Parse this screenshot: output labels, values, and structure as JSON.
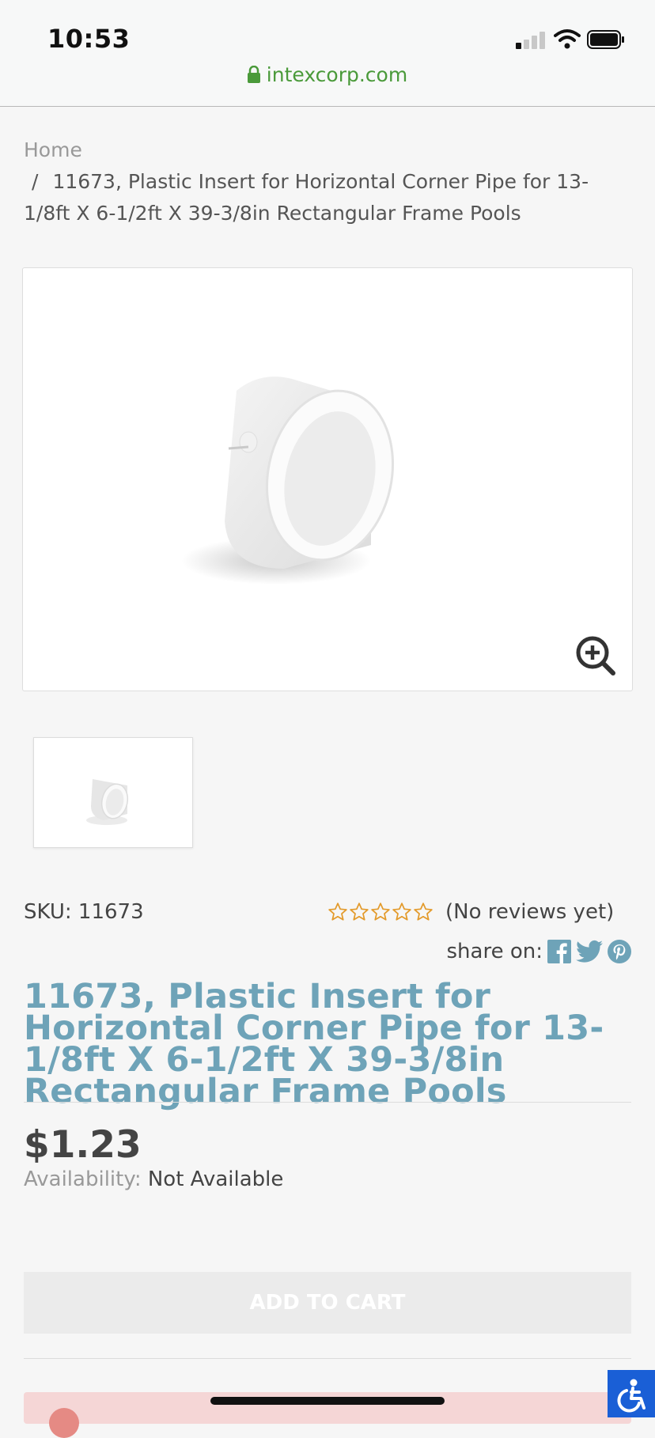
{
  "status_bar": {
    "time": "10:53",
    "url": "intexcorp.com"
  },
  "breadcrumb": {
    "home": "Home",
    "separator": "/",
    "current": "11673, Plastic Insert for Horizontal Corner Pipe for 13-1/8ft X 6-1/2ft X 39-3/8in Rectangular Frame Pools"
  },
  "product": {
    "sku_label": "SKU:",
    "sku": "11673",
    "rating_stars": 0,
    "reviews_text": "(No reviews yet)",
    "share_label": "share on:",
    "title": "11673, Plastic Insert for Horizontal Corner Pipe for 13-1/8ft X 6-1/2ft X 39-3/8in Rectangular Frame Pools",
    "price": "$1.23",
    "availability_label": "Availability:",
    "availability_value": "Not Available",
    "add_to_cart": "ADD TO CART"
  },
  "icons": {
    "lock": "lock-icon",
    "zoom": "zoom-in-icon",
    "facebook": "facebook-icon",
    "twitter": "twitter-icon",
    "pinterest": "pinterest-icon",
    "accessibility": "accessibility-icon"
  },
  "colors": {
    "title": "#6ea3b8",
    "star": "#e39a2a",
    "url": "#4a9a3a",
    "share_icons": "#6ea3b8",
    "accessibility": "#1a5fd6"
  }
}
